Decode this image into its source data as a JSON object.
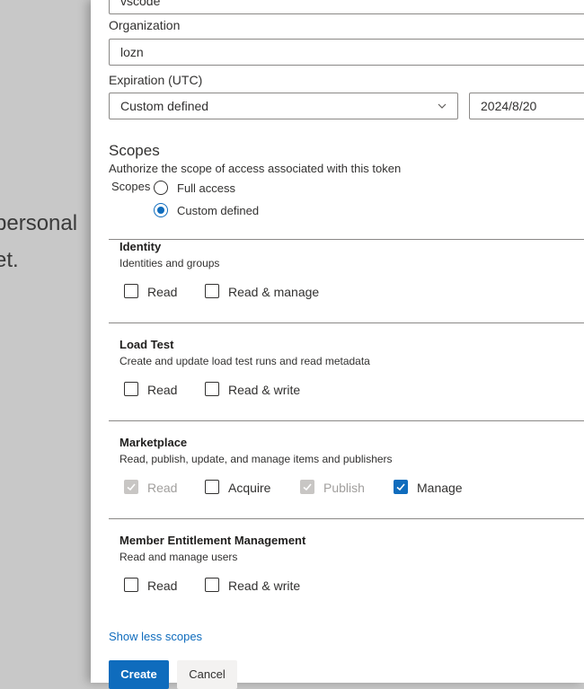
{
  "background": {
    "lines": [
      "personal",
      "et."
    ]
  },
  "form": {
    "name_value": "vscode",
    "organization_label": "Organization",
    "organization_value": "lozn",
    "expiration_label": "Expiration (UTC)",
    "expiration_select_value": "Custom defined",
    "expiration_date_value": "2024/8/20"
  },
  "scopes": {
    "heading": "Scopes",
    "description": "Authorize the scope of access associated with this token",
    "radio_group_label": "Scopes",
    "options": [
      {
        "label": "Full access",
        "selected": false
      },
      {
        "label": "Custom defined",
        "selected": true
      }
    ],
    "sections": [
      {
        "title": "Identity",
        "description": "Identities and groups",
        "checkboxes": [
          {
            "label": "Read",
            "checked": false,
            "disabled": false
          },
          {
            "label": "Read & manage",
            "checked": false,
            "disabled": false
          }
        ]
      },
      {
        "title": "Load Test",
        "description": "Create and update load test runs and read metadata",
        "checkboxes": [
          {
            "label": "Read",
            "checked": false,
            "disabled": false
          },
          {
            "label": "Read & write",
            "checked": false,
            "disabled": false
          }
        ]
      },
      {
        "title": "Marketplace",
        "description": "Read, publish, update, and manage items and publishers",
        "checkboxes": [
          {
            "label": "Read",
            "checked": true,
            "disabled": true
          },
          {
            "label": "Acquire",
            "checked": false,
            "disabled": false
          },
          {
            "label": "Publish",
            "checked": true,
            "disabled": true
          },
          {
            "label": "Manage",
            "checked": true,
            "disabled": false
          }
        ]
      },
      {
        "title": "Member Entitlement Management",
        "description": "Read and manage users",
        "checkboxes": [
          {
            "label": "Read",
            "checked": false,
            "disabled": false
          },
          {
            "label": "Read & write",
            "checked": false,
            "disabled": false
          }
        ]
      }
    ],
    "toggle_link": "Show less scopes"
  },
  "actions": {
    "create_label": "Create",
    "cancel_label": "Cancel"
  },
  "colors": {
    "accent": "#0f6cbd",
    "backdrop": "#c8c8c8"
  }
}
